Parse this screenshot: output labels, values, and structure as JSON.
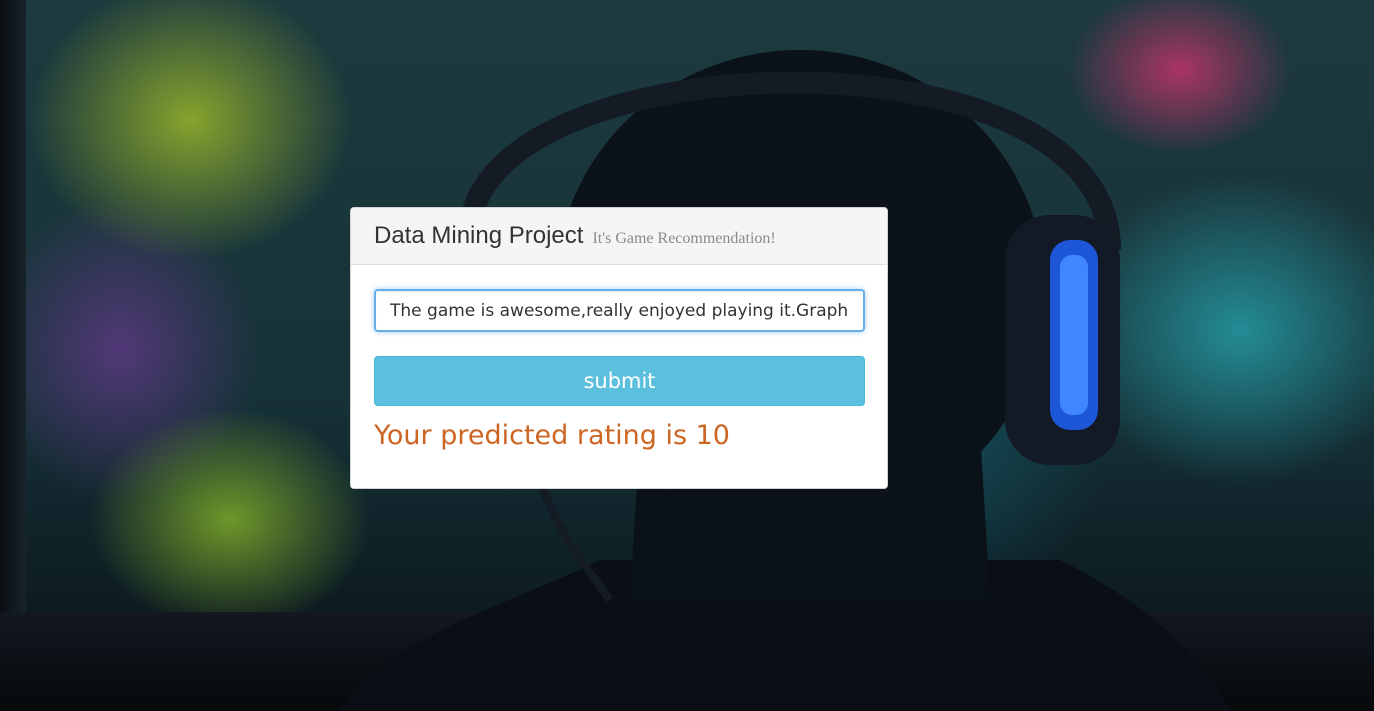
{
  "header": {
    "title": "Data Mining Project",
    "subtitle": "It's Game Recommendation!"
  },
  "form": {
    "review_value": "The game is awesome,really enjoyed playing it.Graphics are great",
    "submit_label": "submit"
  },
  "result": {
    "text": "Your predicted rating is 10"
  },
  "colors": {
    "submit_button": "#5bc0de",
    "result_text": "#cd6523",
    "input_focus_border": "#66afe9"
  }
}
